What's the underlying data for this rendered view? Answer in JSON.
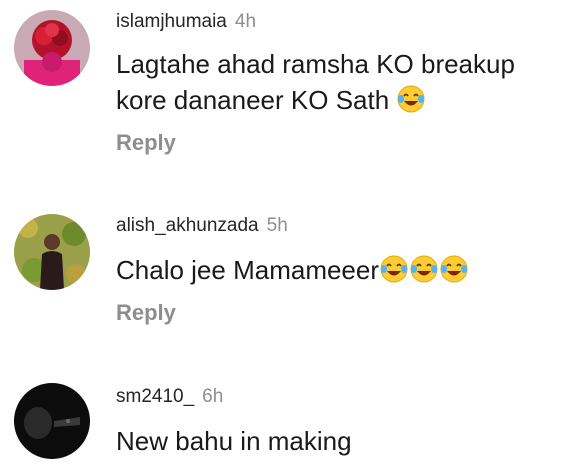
{
  "comments": [
    {
      "username": "islamjhumaia",
      "time": "4h",
      "text_line1": "Lagtahe ahad ramsha KO breakup",
      "text_line2": "kore dananeer KO Sath",
      "emoji": "face-with-tears-of-joy-icon",
      "emoji_count": 1,
      "reply_label": "Reply"
    },
    {
      "username": "alish_akhunzada",
      "time": "5h",
      "text_line1": "Chalo jee Mamameeer",
      "emoji": "face-with-tears-of-joy-icon",
      "emoji_count": 3,
      "reply_label": "Reply"
    },
    {
      "username": "sm2410_",
      "time": "6h",
      "text_line1": "New bahu in making"
    }
  ],
  "colors": {
    "username": "#262626",
    "muted": "#8e8e8e",
    "text": "#1a1a1a"
  }
}
